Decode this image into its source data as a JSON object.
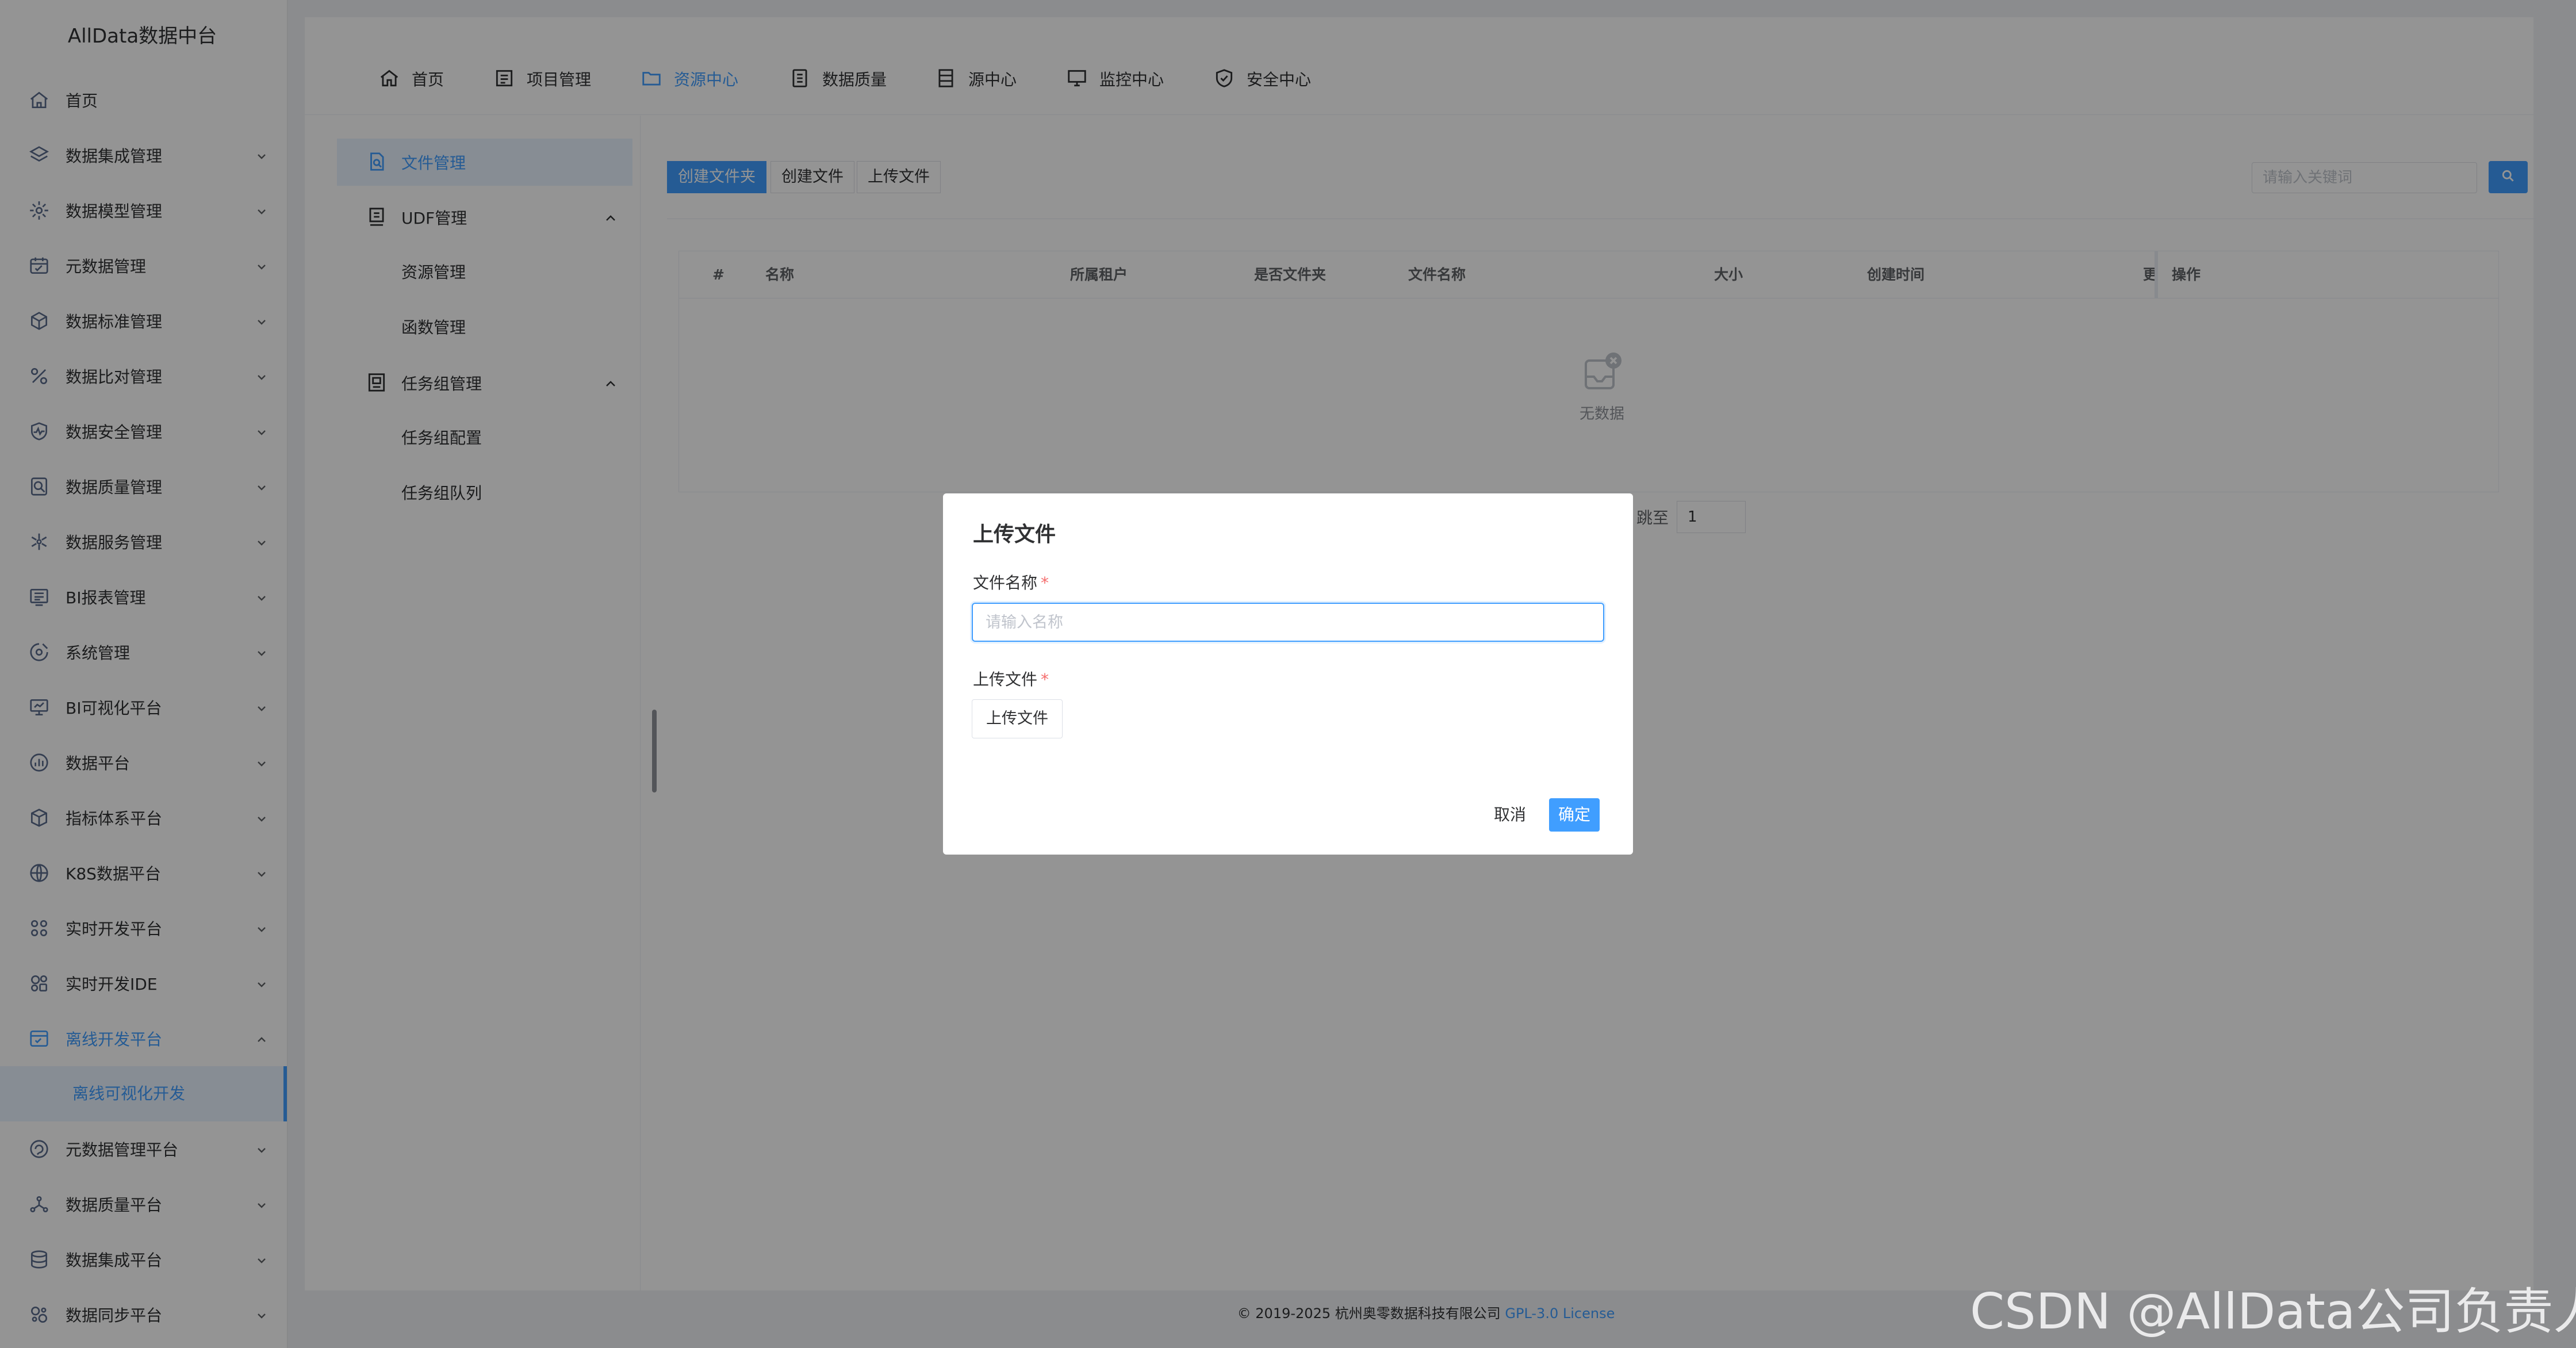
{
  "app": {
    "title": "AllData数据中台"
  },
  "sidebar": {
    "items": [
      {
        "label": "首页",
        "icon": "home-icon"
      },
      {
        "label": "数据集成管理",
        "icon": "layers-icon"
      },
      {
        "label": "数据模型管理",
        "icon": "gear-icon"
      },
      {
        "label": "元数据管理",
        "icon": "calendar-icon"
      },
      {
        "label": "数据标准管理",
        "icon": "cube-icon"
      },
      {
        "label": "数据比对管理",
        "icon": "percent-icon"
      },
      {
        "label": "数据安全管理",
        "icon": "shield-pulse-icon"
      },
      {
        "label": "数据质量管理",
        "icon": "search-doc-icon"
      },
      {
        "label": "数据服务管理",
        "icon": "asterisk-icon"
      },
      {
        "label": "BI报表管理",
        "icon": "report-icon"
      },
      {
        "label": "系统管理",
        "icon": "cog-icon"
      },
      {
        "label": "BI可视化平台",
        "icon": "monitor-icon"
      },
      {
        "label": "数据平台",
        "icon": "bar-circle-icon"
      },
      {
        "label": "指标体系平台",
        "icon": "box-icon"
      },
      {
        "label": "K8S数据平台",
        "icon": "globe-icon"
      },
      {
        "label": "实时开发平台",
        "icon": "nodes-icon"
      },
      {
        "label": "实时开发IDE",
        "icon": "ide-icon"
      },
      {
        "label": "离线开发平台",
        "icon": "offline-icon"
      }
    ],
    "active_sub": "离线可视化开发",
    "items_after": [
      {
        "label": "元数据管理平台",
        "icon": "refresh-circle-icon"
      },
      {
        "label": "数据质量平台",
        "icon": "network-icon"
      },
      {
        "label": "数据集成平台",
        "icon": "database-icon"
      },
      {
        "label": "数据同步平台",
        "icon": "sync-icon"
      }
    ]
  },
  "topnav": {
    "tabs": [
      {
        "label": "首页"
      },
      {
        "label": "项目管理"
      },
      {
        "label": "资源中心"
      },
      {
        "label": "数据质量"
      },
      {
        "label": "源中心"
      },
      {
        "label": "监控中心"
      },
      {
        "label": "安全中心"
      }
    ],
    "active": "资源中心"
  },
  "subnav": {
    "file_mgmt": "文件管理",
    "udf_mgmt": "UDF管理",
    "resource_mgmt": "资源管理",
    "function_mgmt": "函数管理",
    "task_group_mgmt": "任务组管理",
    "task_group_config": "任务组配置",
    "task_group_queue": "任务组队列"
  },
  "toolbar": {
    "create_folder": "创建文件夹",
    "create_file": "创建文件",
    "upload_file": "上传文件",
    "search_placeholder": "请输入关键词"
  },
  "table": {
    "columns": [
      "#",
      "名称",
      "所属租户",
      "是否文件夹",
      "文件名称",
      "大小",
      "创建时间",
      "更",
      "操作"
    ],
    "empty_text": "无数据"
  },
  "pager": {
    "jump_label": "跳至",
    "jump_value": "1"
  },
  "dialog": {
    "title": "上传文件",
    "name_label": "文件名称",
    "name_placeholder": "请输入名称",
    "file_label": "上传文件",
    "upload_button": "上传文件",
    "cancel": "取消",
    "confirm": "确定",
    "required_mark": "*"
  },
  "footer": {
    "copyright": "© 2019-2025 杭州奥零数据科技有限公司",
    "license": "GPL-3.0 License"
  },
  "watermark": "CSDN @AllData公司负责人",
  "colors": {
    "primary": "#409eff",
    "overlay": "rgba(0,0,0,0.42)",
    "danger": "#f56c6c"
  }
}
